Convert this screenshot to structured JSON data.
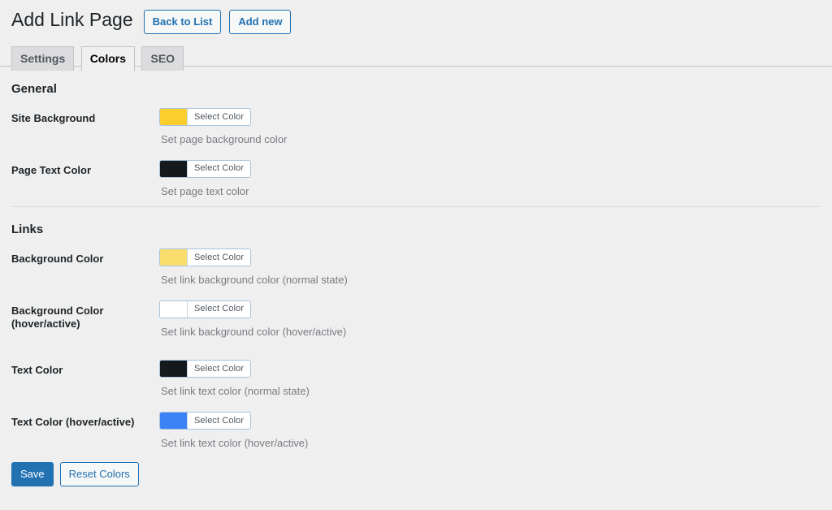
{
  "header": {
    "title": "Add Link Page",
    "actions": [
      {
        "label": "Back to List",
        "name": "back-to-list-button"
      },
      {
        "label": "Add new",
        "name": "add-new-button"
      }
    ]
  },
  "tabs": [
    {
      "label": "Settings",
      "active": false
    },
    {
      "label": "Colors",
      "active": true
    },
    {
      "label": "SEO",
      "active": false
    }
  ],
  "sections": [
    {
      "title": "General",
      "fields": [
        {
          "label": "Site Background",
          "button_label": "Select Color",
          "color": "#FACE2D",
          "description": "Set page background color"
        },
        {
          "label": "Page Text Color",
          "button_label": "Select Color",
          "color": "#16191C",
          "description": "Set page text color"
        }
      ]
    },
    {
      "title": "Links",
      "fields": [
        {
          "label": "Background Color",
          "button_label": "Select Color",
          "color": "#F9DE6E",
          "description": "Set link background color (normal state)"
        },
        {
          "label": "Background Color (hover/active)",
          "button_label": "Select Color",
          "color": "#FFFFFF",
          "description": "Set link background color (hover/active)"
        },
        {
          "label": "Text Color",
          "button_label": "Select Color",
          "color": "#16191C",
          "description": "Set link text color (normal state)"
        },
        {
          "label": "Text Color (hover/active)",
          "button_label": "Select Color",
          "color": "#3B82F6",
          "description": "Set link text color (hover/active)"
        }
      ]
    }
  ],
  "footer": {
    "save_label": "Save",
    "reset_label": "Reset Colors"
  },
  "theme": {
    "page_background": "#efefef",
    "primary": "#2271b1",
    "text": "#1d2327",
    "muted_text": "#787c82",
    "tab_inactive_bg": "#dcdcde",
    "tab_active_bg": "#f0f0f1",
    "border": "#c3c4c7"
  }
}
